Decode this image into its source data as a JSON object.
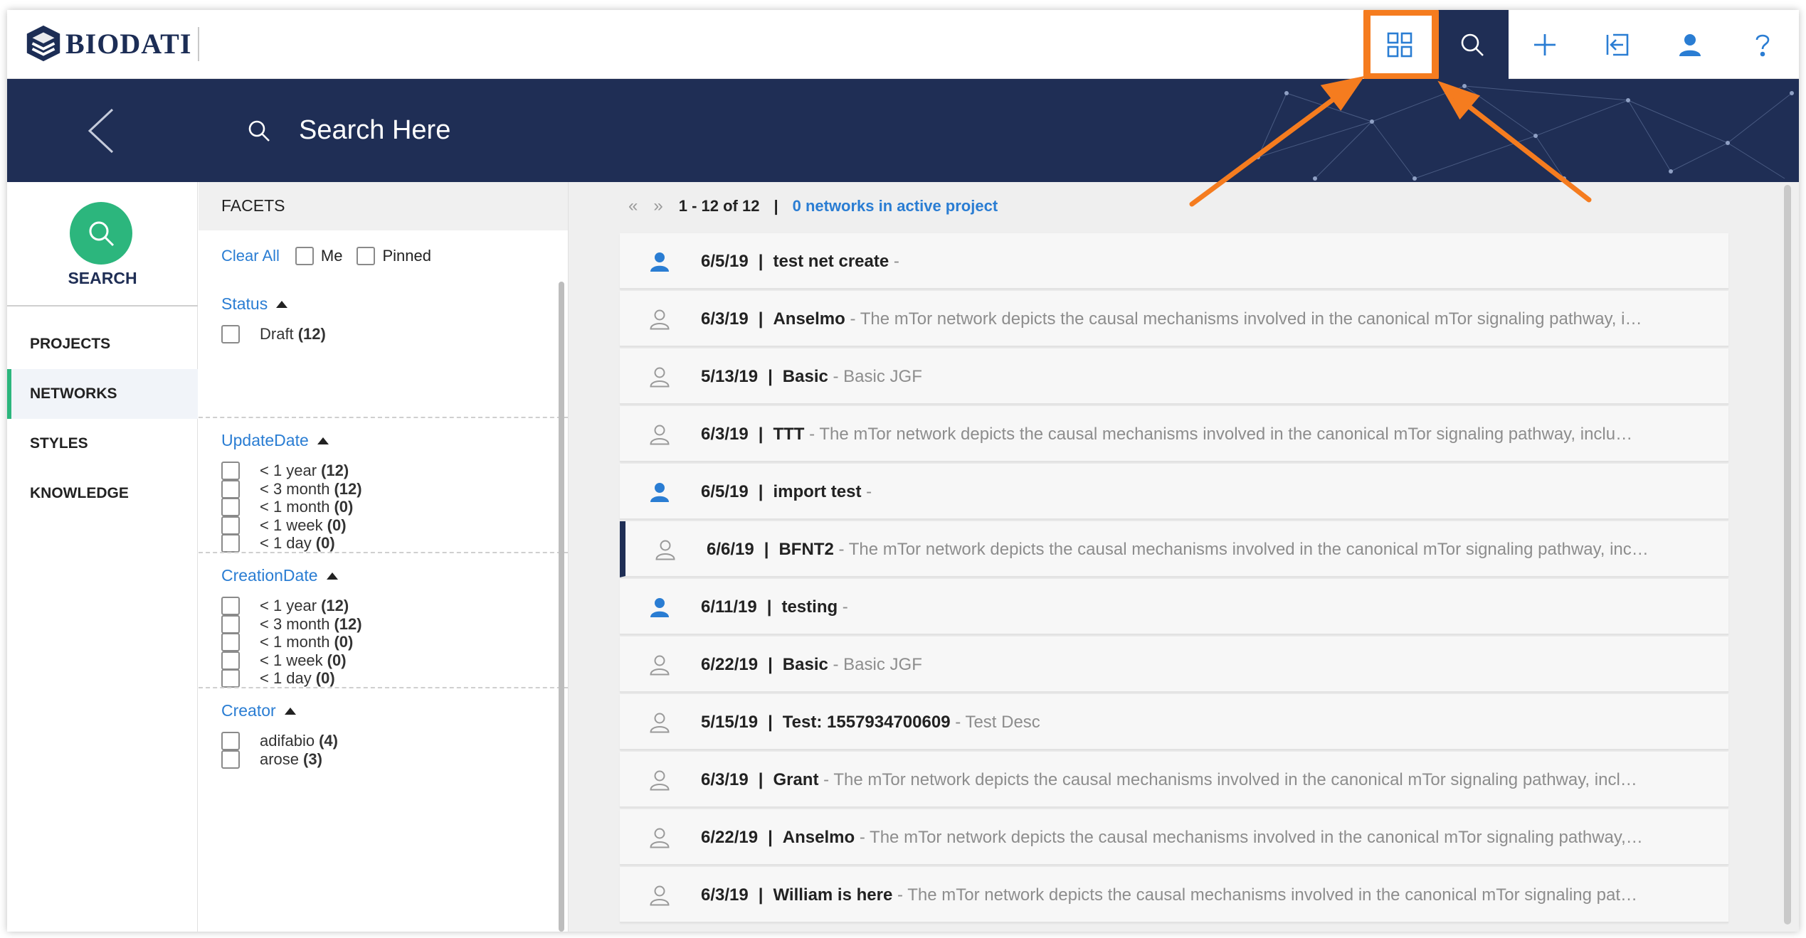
{
  "app": {
    "brand": "BIODATI",
    "accent": "#2cb67d",
    "navy": "#1f2e55",
    "link_color": "#2a7dd3",
    "highlight": "#f57c1f"
  },
  "toolbar": {
    "icons": [
      "grid-icon",
      "search-icon",
      "plus-icon",
      "import-icon",
      "user-icon",
      "help-icon"
    ]
  },
  "search": {
    "placeholder": "Search Here"
  },
  "nav": {
    "search_label": "SEARCH",
    "items": [
      {
        "label": "PROJECTS",
        "active": false
      },
      {
        "label": "NETWORKS",
        "active": true
      },
      {
        "label": "STYLES",
        "active": false
      },
      {
        "label": "KNOWLEDGE",
        "active": false
      }
    ]
  },
  "facets": {
    "title": "FACETS",
    "clear_all": "Clear All",
    "me": "Me",
    "pinned": "Pinned",
    "groups": [
      {
        "title": "Status",
        "options": [
          {
            "label": "Draft",
            "count": "(12)"
          }
        ]
      },
      {
        "title": "UpdateDate",
        "options": [
          {
            "label": "< 1 year",
            "count": "(12)"
          },
          {
            "label": "< 3 month",
            "count": "(12)"
          },
          {
            "label": "< 1 month",
            "count": "(0)"
          },
          {
            "label": "< 1 week",
            "count": "(0)"
          },
          {
            "label": "< 1 day",
            "count": "(0)"
          }
        ]
      },
      {
        "title": "CreationDate",
        "options": [
          {
            "label": "< 1 year",
            "count": "(12)"
          },
          {
            "label": "< 3 month",
            "count": "(12)"
          },
          {
            "label": "< 1 month",
            "count": "(0)"
          },
          {
            "label": "< 1 week",
            "count": "(0)"
          },
          {
            "label": "< 1 day",
            "count": "(0)"
          }
        ]
      },
      {
        "title": "Creator",
        "options": [
          {
            "label": "adifabio",
            "count": "(4)"
          },
          {
            "label": "arose",
            "count": "(3)"
          }
        ]
      }
    ]
  },
  "pager": {
    "prev": "«",
    "next": "»",
    "range": "1 - 12 of 12",
    "separator": "|",
    "active_project": "0 networks in active project"
  },
  "networks": [
    {
      "owned": true,
      "date": "6/5/19",
      "name": "test net create",
      "desc": " -",
      "selected": false
    },
    {
      "owned": false,
      "date": "6/3/19",
      "name": "Anselmo",
      "desc": " - The mTor network depicts the causal mechanisms involved in the canonical mTor signaling pathway, i…",
      "selected": false
    },
    {
      "owned": false,
      "date": "5/13/19",
      "name": "Basic",
      "desc": " - Basic JGF",
      "selected": false
    },
    {
      "owned": false,
      "date": "6/3/19",
      "name": "TTT",
      "desc": " - The mTor network depicts the causal mechanisms involved in the canonical mTor signaling pathway, inclu…",
      "selected": false
    },
    {
      "owned": true,
      "date": "6/5/19",
      "name": "import test",
      "desc": " -",
      "selected": false
    },
    {
      "owned": false,
      "date": "6/6/19",
      "name": "BFNT2",
      "desc": " - The mTor network depicts the causal mechanisms involved in the canonical mTor signaling pathway, inc…",
      "selected": true
    },
    {
      "owned": true,
      "date": "6/11/19",
      "name": "testing",
      "desc": " -",
      "selected": false
    },
    {
      "owned": false,
      "date": "6/22/19",
      "name": "Basic",
      "desc": " - Basic JGF",
      "selected": false
    },
    {
      "owned": false,
      "date": "5/15/19",
      "name": "Test: 1557934700609",
      "desc": " - Test Desc",
      "selected": false
    },
    {
      "owned": false,
      "date": "6/3/19",
      "name": "Grant",
      "desc": " - The mTor network depicts the causal mechanisms involved in the canonical mTor signaling pathway, incl…",
      "selected": false
    },
    {
      "owned": false,
      "date": "6/22/19",
      "name": "Anselmo",
      "desc": " - The mTor network depicts the causal mechanisms involved in the canonical mTor signaling pathway,…",
      "selected": false
    },
    {
      "owned": false,
      "date": "6/3/19",
      "name": "William is here",
      "desc": " - The mTor network depicts the causal mechanisms involved in the canonical mTor signaling pat…",
      "selected": false
    }
  ]
}
